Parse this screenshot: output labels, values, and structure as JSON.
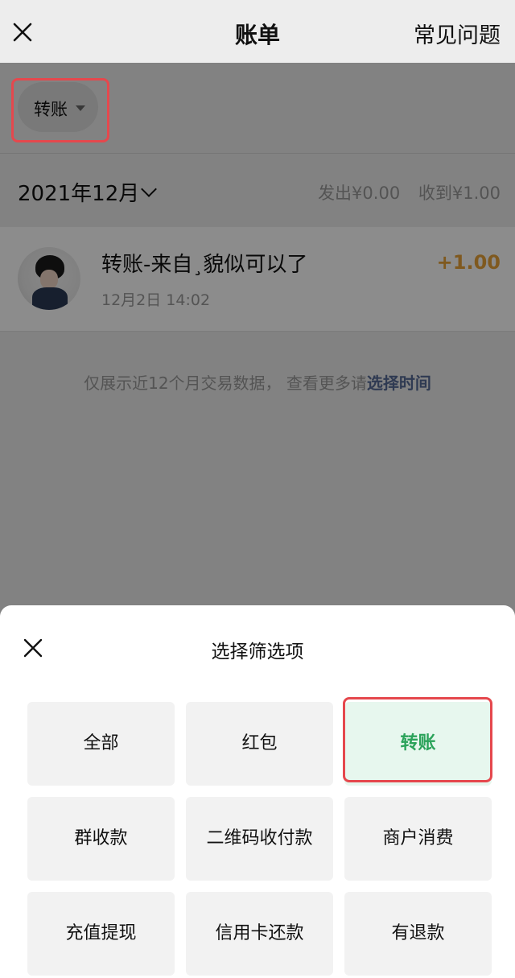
{
  "header": {
    "title": "账单",
    "faq_label": "常见问题",
    "close_icon": "close-icon"
  },
  "filter": {
    "selected_label": "转账",
    "caret_icon": "caret-down-icon"
  },
  "month_section": {
    "month_label": "2021年12月",
    "sent_label": "发出¥0.00",
    "received_label": "收到¥1.00"
  },
  "transactions": [
    {
      "title": "转账-来自¸貌似可以了",
      "date": "12月2日 14:02",
      "amount": "+1.00"
    }
  ],
  "note": {
    "text": "仅展示近12个月交易数据， 查看更多请",
    "link_label": "选择时间"
  },
  "sheet": {
    "title": "选择筛选项",
    "options": [
      {
        "label": "全部",
        "active": false
      },
      {
        "label": "红包",
        "active": false
      },
      {
        "label": "转账",
        "active": true
      },
      {
        "label": "群收款",
        "active": false
      },
      {
        "label": "二维码收付款",
        "active": false
      },
      {
        "label": "商户消费",
        "active": false
      },
      {
        "label": "充值提现",
        "active": false
      },
      {
        "label": "信用卡还款",
        "active": false
      },
      {
        "label": "有退款",
        "active": false
      }
    ]
  },
  "colors": {
    "active_green": "#2ba35a",
    "amount_orange": "#e8a33a",
    "link_blue": "#576b95",
    "highlight_red": "#e5484d"
  }
}
